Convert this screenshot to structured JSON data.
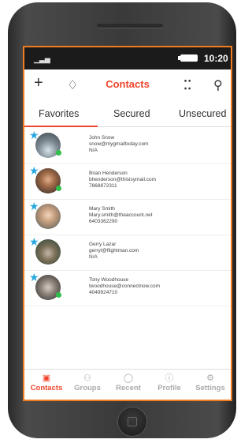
{
  "status": {
    "signal_icon": "signal-icon",
    "time": "10:20"
  },
  "appbar": {
    "title": "Contacts",
    "add_icon": "+",
    "bell_icon": "♫",
    "grid_icon": "⁘",
    "search_icon": "⚲"
  },
  "tabs": [
    "Favorites",
    "Secured",
    "Unsecured"
  ],
  "contacts": [
    {
      "name": "John Snow",
      "email": "snow@mygmailtoday.com",
      "phone": "N/A"
    },
    {
      "name": "Brian Henderson",
      "email": "bhenderson@thisisymail.com",
      "phone": "7868872311"
    },
    {
      "name": "Mary Smith",
      "email": "Mary.smith@theaccount.net",
      "phone": "6403362290"
    },
    {
      "name": "Gerry Lazar",
      "email": "gerryl@flightman.com",
      "phone": "N/A"
    },
    {
      "name": "Tony Woodhouse",
      "email": "twoodhouse@connectnow.com",
      "phone": "4049924710"
    }
  ],
  "nav": [
    {
      "label": "Contacts",
      "icon": "▣"
    },
    {
      "label": "Groups",
      "icon": "⚇"
    },
    {
      "label": "Recent",
      "icon": "◯"
    },
    {
      "label": "Profile",
      "icon": "ⓘ"
    },
    {
      "label": "Settings",
      "icon": "⚙"
    }
  ],
  "colors": {
    "accent": "#f0462c",
    "frame": "#f07c1f",
    "star": "#29a8e0",
    "online": "#2ec04a"
  }
}
